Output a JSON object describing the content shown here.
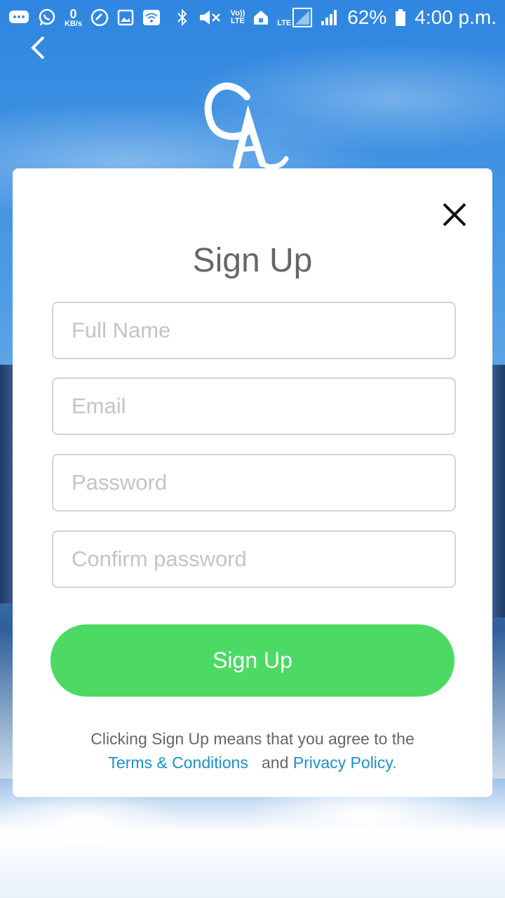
{
  "status_bar": {
    "left_icons": [
      "message-icon",
      "whatsapp-icon",
      "data-speed-icon",
      "phone-icon",
      "image-icon",
      "wifi-icon"
    ],
    "data_speed_value": "0",
    "data_speed_unit": "KB/s",
    "right_icons": [
      "bluetooth-icon",
      "mute-icon",
      "volte-icon",
      "home-icon",
      "lte-signal-icon",
      "signal-icon",
      "battery-icon"
    ],
    "volte_label": "Vo))",
    "volte_sub": "LTE",
    "lte_label": "LTE",
    "battery": "62%",
    "time": "4:00 p.m."
  },
  "nav": {
    "back_icon": "back-chevron-icon"
  },
  "logo": {
    "icon": "app-logo"
  },
  "dialog": {
    "close_icon": "close-icon",
    "title": "Sign Up",
    "fields": {
      "full_name_placeholder": "Full Name",
      "email_placeholder": "Email",
      "password_placeholder": "Password",
      "confirm_password_placeholder": "Confirm password"
    },
    "submit_label": "Sign Up",
    "legal": {
      "prefix": "Clicking Sign Up means that you agree to the",
      "terms_link": "Terms & Conditions",
      "and": "and",
      "privacy_link": "Privacy Policy",
      "suffix": "."
    }
  },
  "colors": {
    "accent_green": "#4cd964",
    "link_blue": "#1f8fc7",
    "title_gray": "#666666",
    "placeholder_gray": "#c4c4c4"
  }
}
